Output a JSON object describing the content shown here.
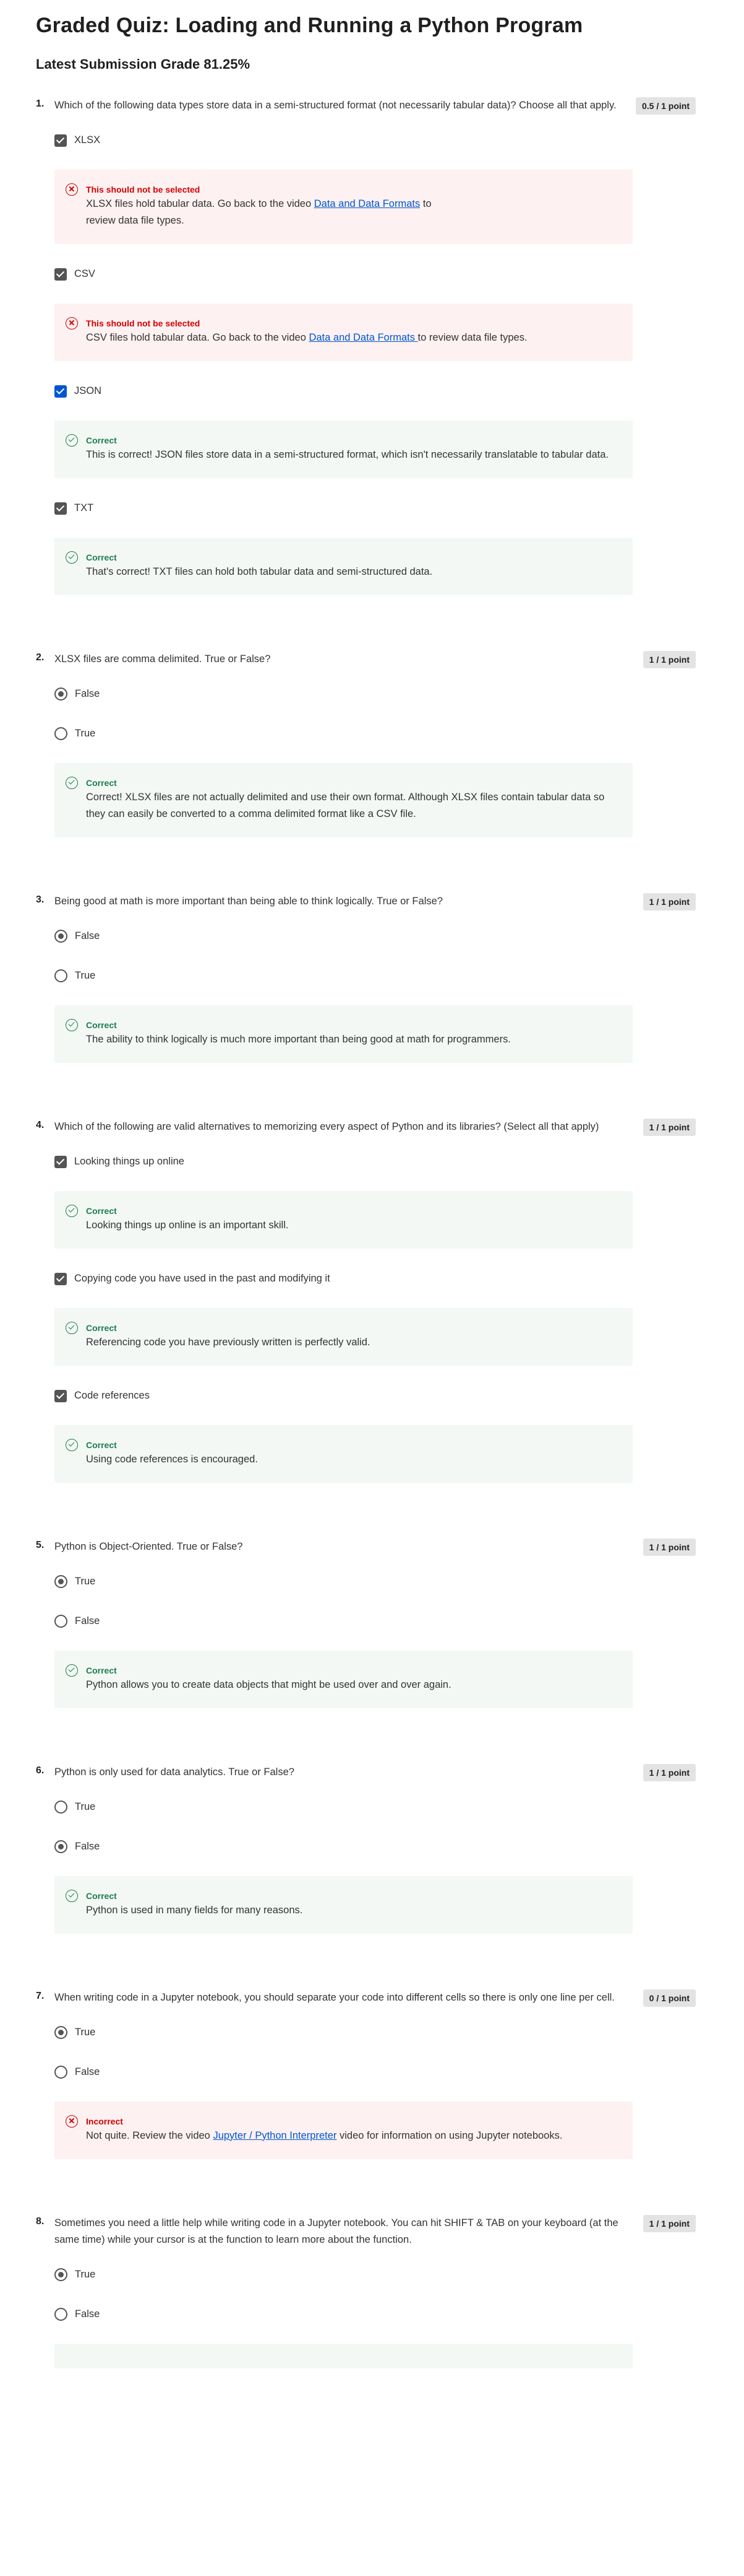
{
  "header": {
    "title": "Graded Quiz: Loading and Running a Python Program",
    "grade": "Latest Submission Grade 81.25%"
  },
  "questions": [
    {
      "num": "1.",
      "text": "Which of the following data types store data in a semi-structured format (not necessarily tabular data)? Choose all that apply.",
      "points": "0.5 / 1 point",
      "options": [
        {
          "label": "XLSX",
          "fb_title": "This should not be selected",
          "fb_pre": "XLSX files hold tabular data. Go back to the video ",
          "fb_link": "Data and Data Formats",
          "fb_post": " to review data file types."
        },
        {
          "label": "CSV",
          "fb_title": "This should not be selected",
          "fb_pre": "CSV files hold tabular data. Go back to the video ",
          "fb_link": "Data and Data Formats ",
          "fb_post": "to review data file types."
        },
        {
          "label": "JSON",
          "fb_title": "Correct",
          "fb_text": "This is correct! JSON files store data in a semi-structured format, which isn't necessarily translatable to tabular data."
        },
        {
          "label": "TXT",
          "fb_title": "Correct",
          "fb_text": "That's correct! TXT files can hold both tabular data and semi-structured data."
        }
      ]
    },
    {
      "num": "2.",
      "text": "XLSX files are comma delimited. True or False?",
      "points": "1 / 1 point",
      "options": [
        {
          "label": "False"
        },
        {
          "label": "True"
        }
      ],
      "fb_title": "Correct",
      "fb_text": "Correct! XLSX files are not actually delimited and use their own format. Although XLSX files contain tabular data so they can easily be converted to a comma delimited format like a CSV file."
    },
    {
      "num": "3.",
      "text": "Being good at math is more important than being able to think logically. True or False?",
      "points": "1 / 1 point",
      "options": [
        {
          "label": "False"
        },
        {
          "label": "True"
        }
      ],
      "fb_title": "Correct",
      "fb_text": "The ability to think logically is much more important than being good at math for programmers."
    },
    {
      "num": "4.",
      "text": "Which of the following are valid alternatives to memorizing every aspect of Python and its libraries? (Select all that apply)",
      "points": "1 / 1 point",
      "options": [
        {
          "label": "Looking things up online",
          "fb_title": "Correct",
          "fb_text": "Looking things up online is an important skill."
        },
        {
          "label": "Copying code you have used in the past and modifying it",
          "fb_title": "Correct",
          "fb_text": "Referencing code you have previously written is perfectly valid."
        },
        {
          "label": "Code references",
          "fb_title": "Correct",
          "fb_text": "Using code references is encouraged."
        }
      ]
    },
    {
      "num": "5.",
      "text": "Python is Object-Oriented. True or False?",
      "points": "1 / 1 point",
      "options": [
        {
          "label": "True"
        },
        {
          "label": "False"
        }
      ],
      "fb_title": "Correct",
      "fb_text": "Python allows you to create data objects that might be used over and over again."
    },
    {
      "num": "6.",
      "text": "Python is only used for data analytics. True or False?",
      "points": "1 / 1 point",
      "options": [
        {
          "label": "True"
        },
        {
          "label": "False"
        }
      ],
      "fb_title": "Correct",
      "fb_text": "Python is used in many fields for many reasons."
    },
    {
      "num": "7.",
      "text": "When writing code in a Jupyter notebook, you should separate your code into different cells so there is only one line per cell.",
      "points": "0 / 1 point",
      "options": [
        {
          "label": "True"
        },
        {
          "label": "False"
        }
      ],
      "fb_title": "Incorrect",
      "fb_pre": "Not quite. Review the video ",
      "fb_link": "Jupyter / Python Interpreter",
      "fb_post": " video for information on using Jupyter notebooks."
    },
    {
      "num": "8.",
      "text": "Sometimes you need a little help while writing code in a Jupyter notebook. You can hit SHIFT & TAB on your keyboard (at the same time) while your cursor is at the function to learn more about the function.",
      "points": "1 / 1 point",
      "options": [
        {
          "label": "True"
        },
        {
          "label": "False"
        }
      ]
    }
  ]
}
